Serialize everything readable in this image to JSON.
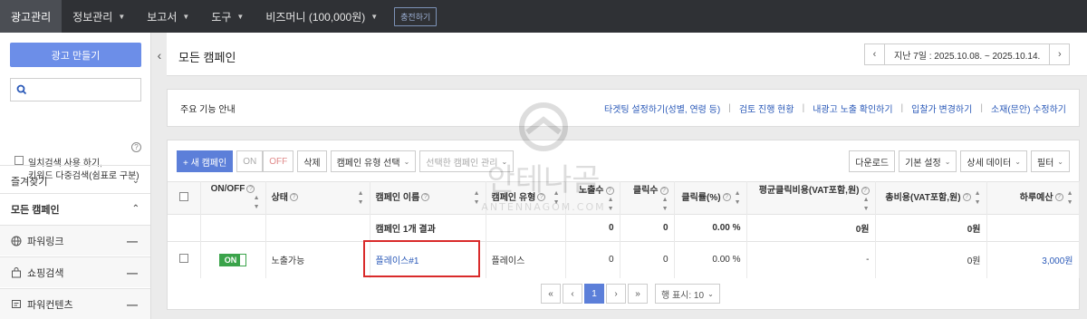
{
  "topnav": {
    "items": [
      "광고관리",
      "정보관리",
      "보고서",
      "도구",
      "비즈머니 (100,000원)"
    ],
    "charge_label": "충전하기"
  },
  "sidebar": {
    "create_label": "광고 만들기",
    "search_placeholder": "",
    "option_line1": "일치검색 사용 하기,",
    "option_line2": "키워드 다중검색(쉼표로 구분)",
    "favorites": "즐겨찾기",
    "all_campaigns": "모든 캠페인",
    "types": [
      "파워링크",
      "쇼핑검색",
      "파워컨텐츠"
    ]
  },
  "header": {
    "title": "모든 캠페인",
    "date_range": "지난 7일 : 2025.10.08. ~ 2025.10.14."
  },
  "guide": {
    "title": "주요 기능 안내",
    "links": [
      "타겟팅 설정하기(성별, 연령 등)",
      "검토 진행 현황",
      "내광고 노출 확인하기",
      "입찰가 변경하기",
      "소재(문안) 수정하기"
    ]
  },
  "toolbar": {
    "new_campaign": "+ 새 캠페인",
    "on": "ON",
    "off": "OFF",
    "delete": "삭제",
    "type_select": "캠페인 유형 선택",
    "manage": "선택한 캠페인 관리",
    "download": "다운로드",
    "basic_setting": "기본 설정",
    "detail_data": "상세 데이터",
    "filter": "필터"
  },
  "table": {
    "headers": {
      "onoff": "ON/OFF",
      "status": "상태",
      "name": "캠페인 이름",
      "type": "캠페인 유형",
      "impressions": "노출수",
      "clicks": "클릭수",
      "ctr": "클릭률(%)",
      "cpc": "평균클릭비용(VAT포함,원)",
      "cost": "총비용(VAT포함,원)",
      "budget": "하루예산"
    },
    "summary": {
      "label": "캠페인 1개 결과",
      "impressions": "0",
      "clicks": "0",
      "ctr": "0.00 %",
      "cpc": "0원",
      "cost": "0원"
    },
    "row": {
      "onoff": "ON",
      "status": "노출가능",
      "name": "플레이스#1",
      "type": "플레이스",
      "impressions": "0",
      "clicks": "0",
      "ctr": "0.00 %",
      "cpc": "-",
      "cost": "0원",
      "budget": "3,000원"
    }
  },
  "pagination": {
    "current": "1",
    "rows_label": "행 표시: 10"
  },
  "watermark": {
    "text": "안테나곰",
    "sub": "ANTENNAGOM.COM"
  }
}
